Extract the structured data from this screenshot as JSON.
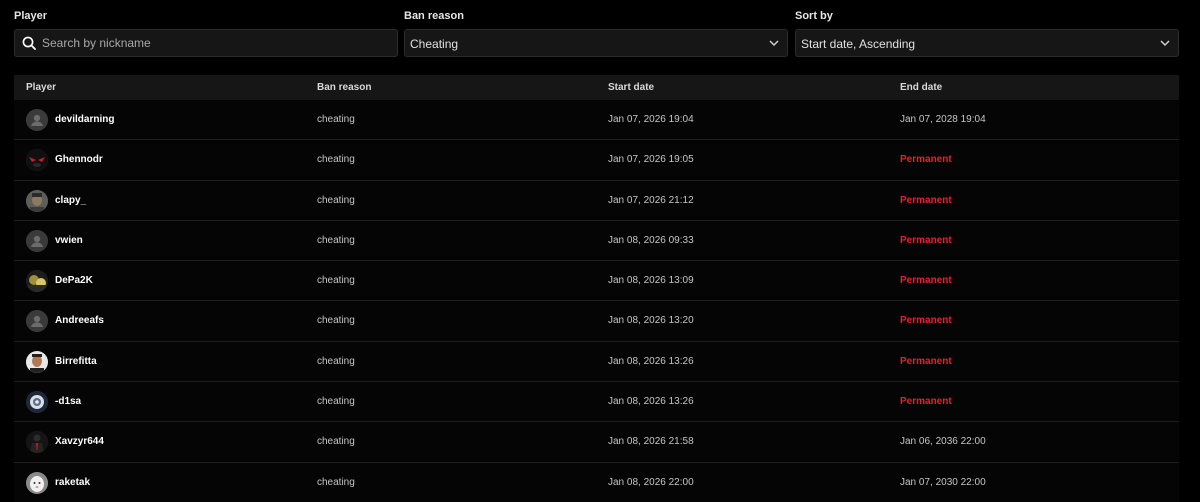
{
  "filters": {
    "player": {
      "label": "Player",
      "placeholder": "Search by nickname",
      "value": ""
    },
    "ban_reason": {
      "label": "Ban reason",
      "value": "Cheating"
    },
    "sort_by": {
      "label": "Sort by",
      "value": "Start date, Ascending"
    }
  },
  "table": {
    "headers": {
      "player": "Player",
      "ban_reason": "Ban reason",
      "start_date": "Start date",
      "end_date": "End date"
    },
    "rows": [
      {
        "nickname": "devildarning",
        "reason": "cheating",
        "start": "Jan 07, 2026 19:04",
        "end": "Jan 07, 2028 19:04",
        "permanent": false,
        "avatar": "default"
      },
      {
        "nickname": "Ghennodr",
        "reason": "cheating",
        "start": "Jan 07, 2026 19:05",
        "end": "Permanent",
        "permanent": true,
        "avatar": "red-eyes"
      },
      {
        "nickname": "clapy_",
        "reason": "cheating",
        "start": "Jan 07, 2026 21:12",
        "end": "Permanent",
        "permanent": true,
        "avatar": "portrait-gray"
      },
      {
        "nickname": "vwien",
        "reason": "cheating",
        "start": "Jan 08, 2026 09:33",
        "end": "Permanent",
        "permanent": true,
        "avatar": "default"
      },
      {
        "nickname": "DePa2K",
        "reason": "cheating",
        "start": "Jan 08, 2026 13:09",
        "end": "Permanent",
        "permanent": true,
        "avatar": "dark-gold"
      },
      {
        "nickname": "Andreeafs",
        "reason": "cheating",
        "start": "Jan 08, 2026 13:20",
        "end": "Permanent",
        "permanent": true,
        "avatar": "default"
      },
      {
        "nickname": "Birrefitta",
        "reason": "cheating",
        "start": "Jan 08, 2026 13:26",
        "end": "Permanent",
        "permanent": true,
        "avatar": "face-light"
      },
      {
        "nickname": "-d1sa",
        "reason": "cheating",
        "start": "Jan 08, 2026 13:26",
        "end": "Permanent",
        "permanent": true,
        "avatar": "blue-white"
      },
      {
        "nickname": "Xavzyr644",
        "reason": "cheating",
        "start": "Jan 08, 2026 21:58",
        "end": "Jan 06, 2036 22:00",
        "permanent": false,
        "avatar": "suit-dark"
      },
      {
        "nickname": "raketak",
        "reason": "cheating",
        "start": "Jan 08, 2026 22:00",
        "end": "Jan 07, 2030 22:00",
        "permanent": false,
        "avatar": "white-animal"
      }
    ]
  },
  "colors": {
    "background": "#000000",
    "permanent": "#e8202a",
    "input_bg": "#161616"
  },
  "icons": {
    "search": "search-icon",
    "dropdown": "chevron-down-icon",
    "avatar_default": "user-icon"
  }
}
